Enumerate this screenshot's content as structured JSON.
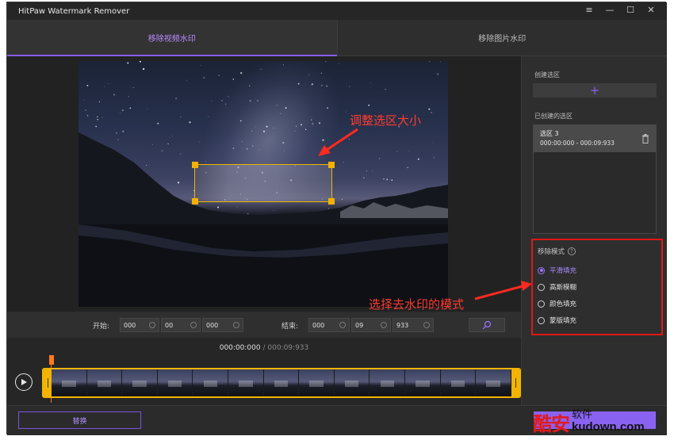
{
  "window": {
    "title": "HitPaw Watermark Remover",
    "controls": [
      "≡",
      "—",
      "☐",
      "✕"
    ]
  },
  "tabs": [
    {
      "label": "移除视频水印",
      "active": true
    },
    {
      "label": "移除图片水印",
      "active": false
    }
  ],
  "annotations": {
    "resize": "调整选区大小",
    "mode": "选择去水印的模式"
  },
  "timebar": {
    "start_label": "开始:",
    "start": [
      "000",
      "00",
      "000"
    ],
    "end_label": "结束:",
    "end": [
      "000",
      "09",
      "933"
    ]
  },
  "timeline": {
    "current": "000:00:000",
    "separator": " / ",
    "total": "000:09:933",
    "thumbnail_count": 13
  },
  "sidebar": {
    "create_label": "创建选区",
    "create_icon": "+",
    "created_label": "已创建的选区",
    "regions": [
      {
        "name": "选区 3",
        "time": "000:00:000 - 000:09:933"
      }
    ],
    "mode_label": "移除模式",
    "modes": [
      {
        "label": "平滑填充",
        "selected": true
      },
      {
        "label": "高斯模糊",
        "selected": false
      },
      {
        "label": "颜色填充",
        "selected": false
      },
      {
        "label": "蒙版填充",
        "selected": false
      }
    ]
  },
  "bottom": {
    "replace_label": "替换"
  },
  "site_watermark": {
    "big": "酷安",
    "top": "软件",
    "url": "kudown.com"
  },
  "colors": {
    "accent": "#8a5cf5",
    "selection": "#f2b400",
    "annotation": "#ff3b2f",
    "highlight_box": "#e01818"
  }
}
